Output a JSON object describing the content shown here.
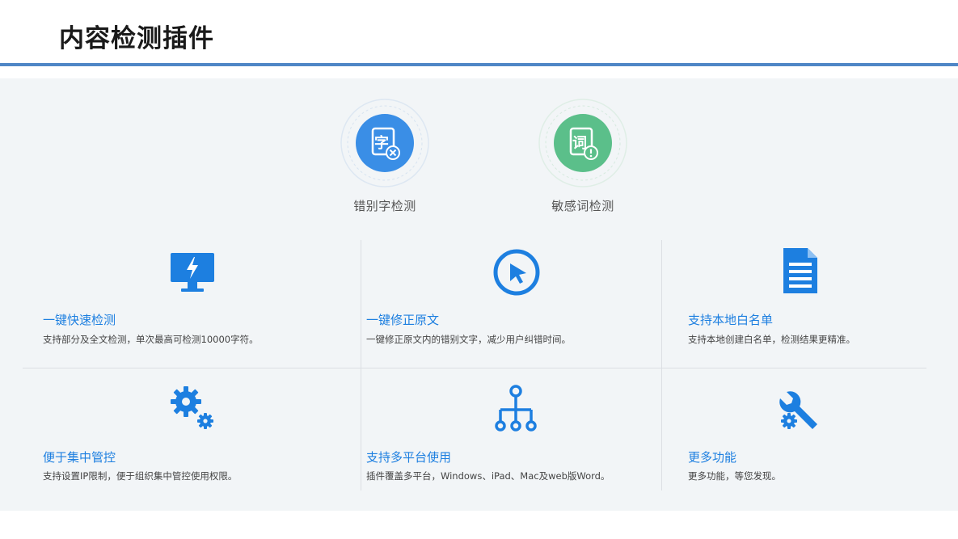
{
  "page_title": "内容检测插件",
  "colors": {
    "accent_blue": "#1d7fe0",
    "rule_blue": "#4f86c6",
    "green": "#5bbf8a"
  },
  "top_features": [
    {
      "label": "错别字检测",
      "icon": "typo-check-icon",
      "char": "字"
    },
    {
      "label": "敏感词检测",
      "icon": "sensitive-word-icon",
      "char": "词"
    }
  ],
  "features": [
    {
      "title": "一键快速检测",
      "desc": "支持部分及全文检测，单次最高可检测10000字符。",
      "icon": "monitor-lightning-icon"
    },
    {
      "title": "一键修正原文",
      "desc": "一键修正原文内的错别文字，减少用户纠错时间。",
      "icon": "cursor-click-icon"
    },
    {
      "title": "支持本地白名单",
      "desc": "支持本地创建白名单，检测结果更精准。",
      "icon": "document-icon"
    },
    {
      "title": "便于集中管控",
      "desc": "支持设置IP限制，便于组织集中管控使用权限。",
      "icon": "gears-icon"
    },
    {
      "title": "支持多平台使用",
      "desc": "插件覆盖多平台，Windows、iPad、Mac及web版Word。",
      "icon": "network-tree-icon"
    },
    {
      "title": "更多功能",
      "desc": "更多功能，等您发现。",
      "icon": "wrench-icon"
    }
  ]
}
